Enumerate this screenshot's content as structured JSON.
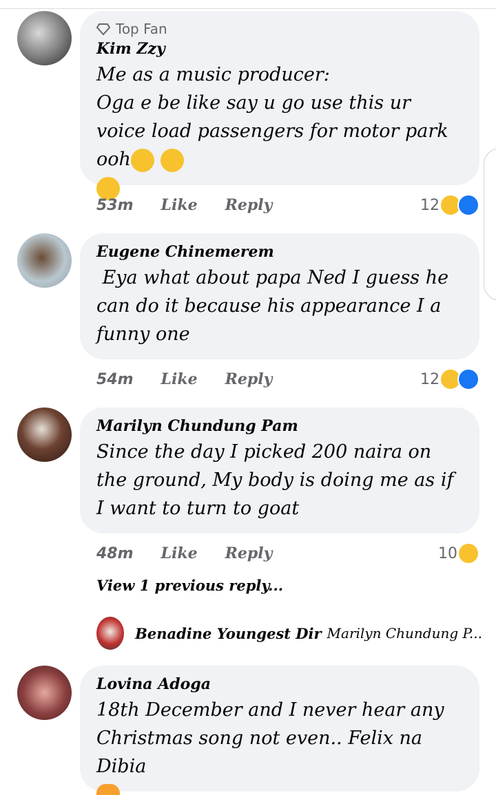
{
  "comments": [
    {
      "badge": "Top Fan",
      "author": "Kim Zzy",
      "text": "Me as a music producer:\nOga e be like say u go use this ur voice load passengers for motor park ooh",
      "time": "53m",
      "like_label": "Like",
      "reply_label": "Reply",
      "reaction_count": "12"
    },
    {
      "author": "Eugene Chinemerem",
      "text": " Eya what about papa Ned I guess he can do it because his appearance I a funny one",
      "time": "54m",
      "like_label": "Like",
      "reply_label": "Reply",
      "reaction_count": "12"
    },
    {
      "author": "Marilyn Chundung Pam",
      "text": "Since the day I picked 200 naira on the ground, My body is doing me as if I want to turn to goat",
      "time": "48m",
      "like_label": "Like",
      "reply_label": "Reply",
      "reaction_count": "10"
    },
    {
      "author": "Lovina Adoga",
      "text": "18th December and I never hear any Christmas song not even.. Felix na Dibia"
    }
  ],
  "replies": {
    "view_previous": "View 1 previous reply...",
    "latest_author": "Benadine Youngest Dir",
    "latest_text": "Marilyn Chundung P..."
  },
  "colors": {
    "bubble": "#f0f2f5",
    "meta_text": "#65676b",
    "like_blue": "#1877f2",
    "haha_yellow": "#f7c22e"
  }
}
